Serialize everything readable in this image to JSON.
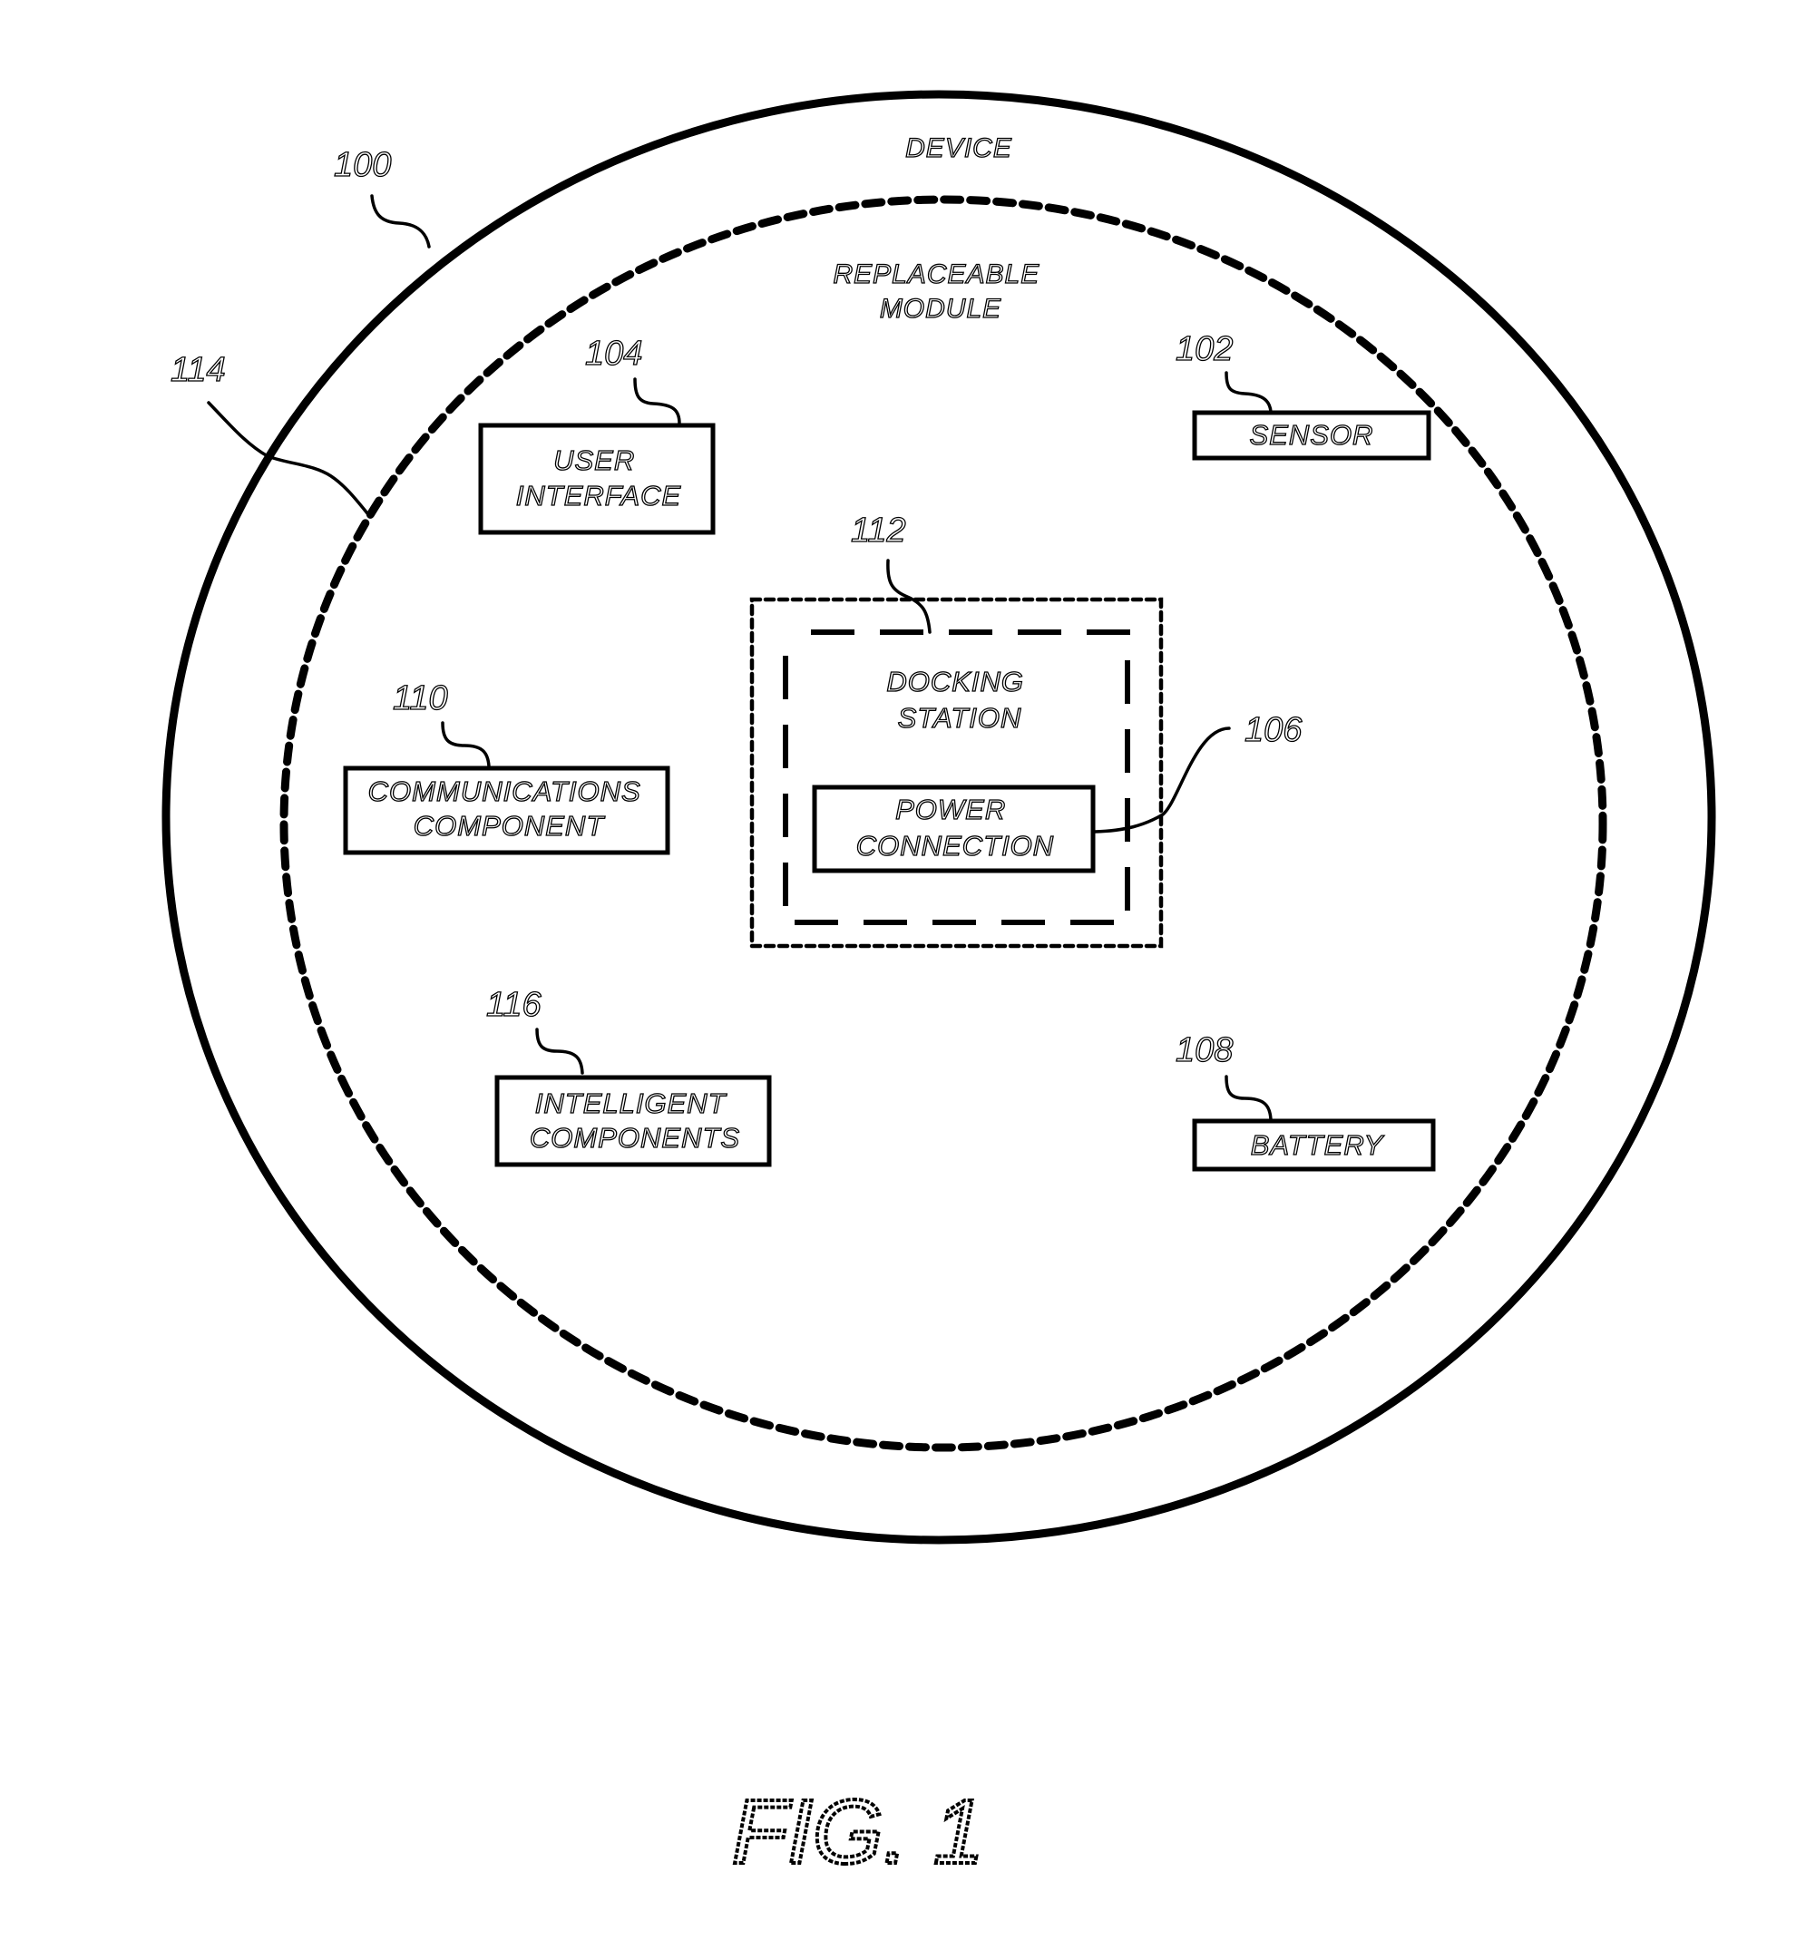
{
  "figure": {
    "caption": "FIG. 1",
    "device": {
      "ref": "100",
      "label": "DEVICE"
    },
    "replaceable_module": {
      "ref": "114",
      "label_lines": [
        "REPLACEABLE",
        "MODULE"
      ]
    },
    "components": {
      "sensor": {
        "ref": "102",
        "label_lines": [
          "SENSOR"
        ]
      },
      "user_interface": {
        "ref": "104",
        "label_lines": [
          "USER",
          "INTERFACE"
        ]
      },
      "power_connection": {
        "ref": "106",
        "label_lines": [
          "POWER",
          "CONNECTION"
        ]
      },
      "battery": {
        "ref": "108",
        "label_lines": [
          "BATTERY"
        ]
      },
      "communications": {
        "ref": "110",
        "label_lines": [
          "COMMUNICATIONS",
          "COMPONENT"
        ]
      },
      "docking_station": {
        "ref": "112",
        "label_lines": [
          "DOCKING",
          "STATION"
        ]
      },
      "intelligent": {
        "ref": "116",
        "label_lines": [
          "INTELLIGENT",
          "COMPONENTS"
        ]
      }
    },
    "colors": {
      "line": "#000000",
      "background": "#ffffff"
    }
  }
}
